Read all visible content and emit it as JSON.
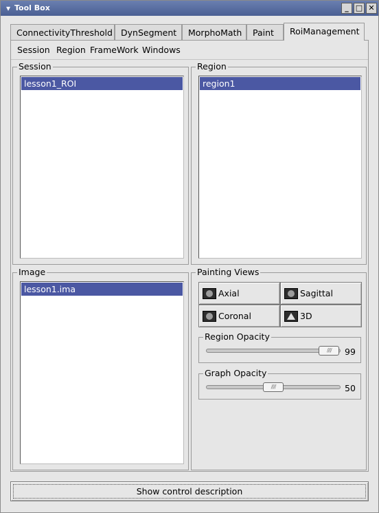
{
  "window": {
    "title": "Tool Box",
    "menu_icon": "▾",
    "minimize_icon": "_",
    "maximize_icon": "□",
    "close_icon": "✕"
  },
  "tabs": [
    {
      "label": "ConnectivityThreshold"
    },
    {
      "label": "DynSegment"
    },
    {
      "label": "MorphoMath"
    },
    {
      "label": "Paint"
    },
    {
      "label": "RoiManagement",
      "active": true
    }
  ],
  "menubar": [
    "Session",
    "Region",
    "FrameWork",
    "Windows"
  ],
  "session": {
    "label": "Session",
    "items": [
      "lesson1_ROI"
    ]
  },
  "region": {
    "label": "Region",
    "items": [
      "region1"
    ]
  },
  "image": {
    "label": "Image",
    "items": [
      "lesson1.ima"
    ]
  },
  "painting_views": {
    "label": "Painting Views",
    "buttons": [
      {
        "label": "Axial",
        "icon": "axial-view-icon"
      },
      {
        "label": "Sagittal",
        "icon": "sagittal-view-icon"
      },
      {
        "label": "Coronal",
        "icon": "coronal-view-icon"
      },
      {
        "label": "3D",
        "icon": "3d-view-icon"
      }
    ]
  },
  "region_opacity": {
    "label": "Region Opacity",
    "value": "99",
    "fraction": 0.99
  },
  "graph_opacity": {
    "label": "Graph Opacity",
    "value": "50",
    "fraction": 0.5
  },
  "footer": {
    "button_label": "Show control description"
  },
  "colors": {
    "selection": "#4b58a3",
    "titlebar": "#5a6fa3",
    "background": "#e6e6e6"
  }
}
